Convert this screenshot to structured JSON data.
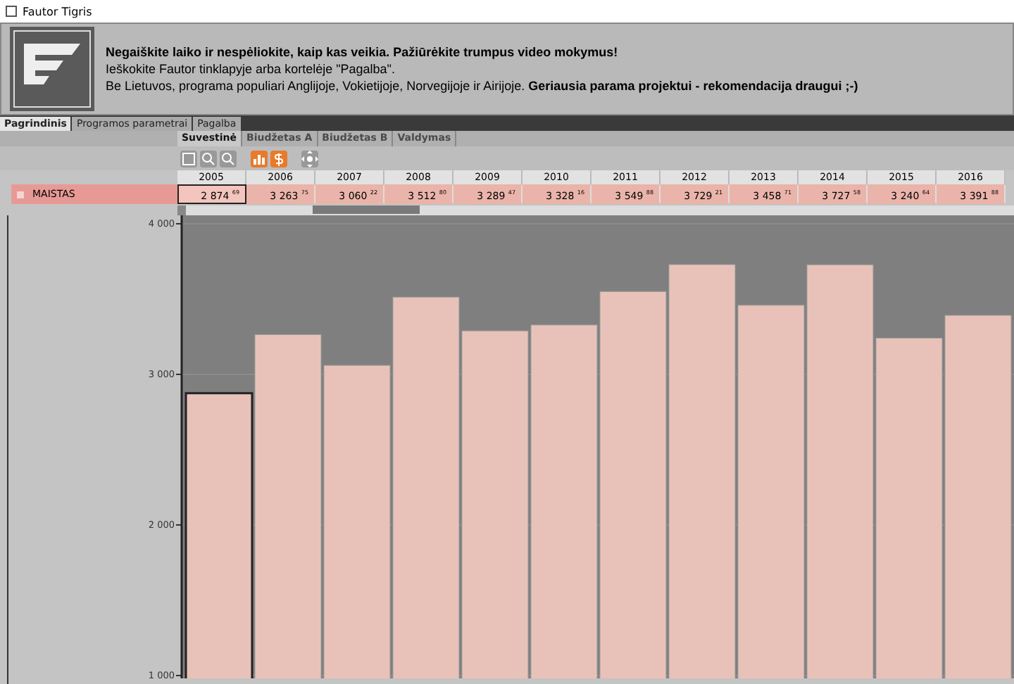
{
  "window": {
    "title": "Fautor Tigris"
  },
  "banner": {
    "lines": [
      "**Negaiškite laiko ir nespėliokite, kaip kas veikia. Pažiūrėkite trumpus video mokymus!**",
      "Ieškokite Fautor tinklapyje arba kortelėje \"Pagalba\".",
      "Be Lietuvos, programa populiari Anglijoje, Vokietijoje, Norvegijoje ir Airijoje. **Geriausia parama projektui - rekomendacija draugui ;-)**"
    ]
  },
  "tabs": [
    {
      "label": "Pagrindinis",
      "selected": true
    },
    {
      "label": "Programos parametrai",
      "selected": false
    },
    {
      "label": "Pagalba",
      "selected": false
    }
  ],
  "subtabs": [
    {
      "label": "Suvestinė",
      "selected": true
    },
    {
      "label": "Biudžetas A",
      "selected": false
    },
    {
      "label": "Biudžetas B",
      "selected": false
    },
    {
      "label": "Valdymas",
      "selected": false
    }
  ],
  "toolbar": [
    {
      "kind": "save",
      "active": false
    },
    {
      "kind": "zoom-in",
      "active": false
    },
    {
      "kind": "zoom-out",
      "active": false
    },
    {
      "kind": "chart",
      "active": true
    },
    {
      "kind": "money",
      "active": true
    },
    {
      "kind": "move",
      "active": false
    }
  ],
  "table": {
    "columns": [
      "2005",
      "2006",
      "2007",
      "2008",
      "2009",
      "2010",
      "2011",
      "2012",
      "2013",
      "2014",
      "2015",
      "2016"
    ],
    "rows": [
      {
        "label": "MAISTAS",
        "cells": [
          {
            "text": "2 874 $^{69}$",
            "selected": true
          },
          {
            "text": "3 263 $^{75}$",
            "selected": false
          },
          {
            "text": "3 060 $^{22}$",
            "selected": false
          },
          {
            "text": "3 512 $^{80}$",
            "selected": false
          },
          {
            "text": "3 289 $^{47}$",
            "selected": false
          },
          {
            "text": "3 328 $^{16}$",
            "selected": false
          },
          {
            "text": "3 549 $^{88}$",
            "selected": false
          },
          {
            "text": "3 729 $^{21}$",
            "selected": false
          },
          {
            "text": "3 458 $^{71}$",
            "selected": false
          },
          {
            "text": "3 727 $^{58}$",
            "selected": false
          },
          {
            "text": "3 240 $^{64}$",
            "selected": false
          },
          {
            "text": "3 391 $^{88}$",
            "selected": false
          }
        ]
      }
    ]
  },
  "chart_data": {
    "type": "bar",
    "values": [
      2875,
      3264,
      3060,
      3513,
      3289,
      3328,
      3550,
      3729,
      3459,
      3728,
      3241,
      3392
    ],
    "ylim": [
      1000,
      4000
    ],
    "yticks": [
      {
        "value": 1000,
        "label": "1 000"
      },
      {
        "value": 2000,
        "label": "2 000"
      },
      {
        "value": 3000,
        "label": "3 000"
      },
      {
        "value": 4000,
        "label": "4 000"
      }
    ]
  }
}
